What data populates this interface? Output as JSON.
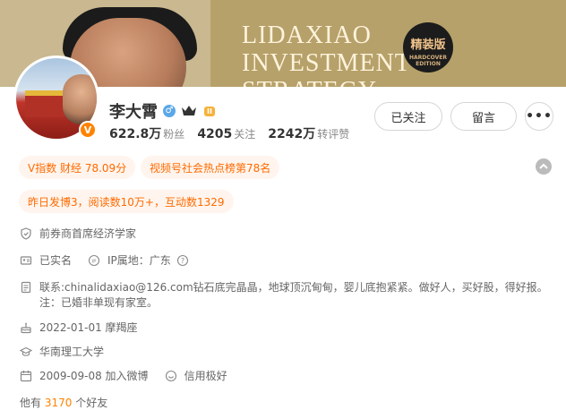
{
  "cover": {
    "title_lines": [
      "LIDAXIAO",
      "INVESTMENT",
      "STRATEGY"
    ],
    "seal_text": "精装版",
    "seal_sub": "HARDCOVER EDITION"
  },
  "profile": {
    "name": "李大霄",
    "verified_badge": "V",
    "level": "II",
    "gender_icon": "♂",
    "stats": [
      {
        "value": "622.8万",
        "label": "粉丝"
      },
      {
        "value": "4205",
        "label": "关注"
      },
      {
        "value": "2242万",
        "label": "转评赞"
      }
    ],
    "buttons": {
      "follow": "已关注",
      "message": "留言",
      "more": "•••"
    }
  },
  "tags": [
    "V指数 财经 78.09分",
    "视频号社会热点榜第78名",
    "昨日发博3，阅读数10万+，互动数1329"
  ],
  "info": {
    "title": "前券商首席经济学家",
    "real_name": "已实名",
    "ip_location": "IP属地：广东",
    "bio_line1": "联系:chinalidaxiao@126.com钻石底完晶晶，地球顶沉甸甸，婴儿底抱紧紧。做好人，买好股，得好报。",
    "bio_line2": "注：已婚非单现有家室。",
    "birthday": "2022-01-01 摩羯座",
    "school": "华南理工大学",
    "joined": "2009-09-08 加入微博",
    "credit": "信用极好"
  },
  "friends": {
    "prefix": "他有",
    "count": "3170",
    "suffix": "个好友"
  },
  "colors": {
    "accent": "#ff8200",
    "tag_text": "#ff6a00",
    "tag_bg": "#fff5ee"
  }
}
